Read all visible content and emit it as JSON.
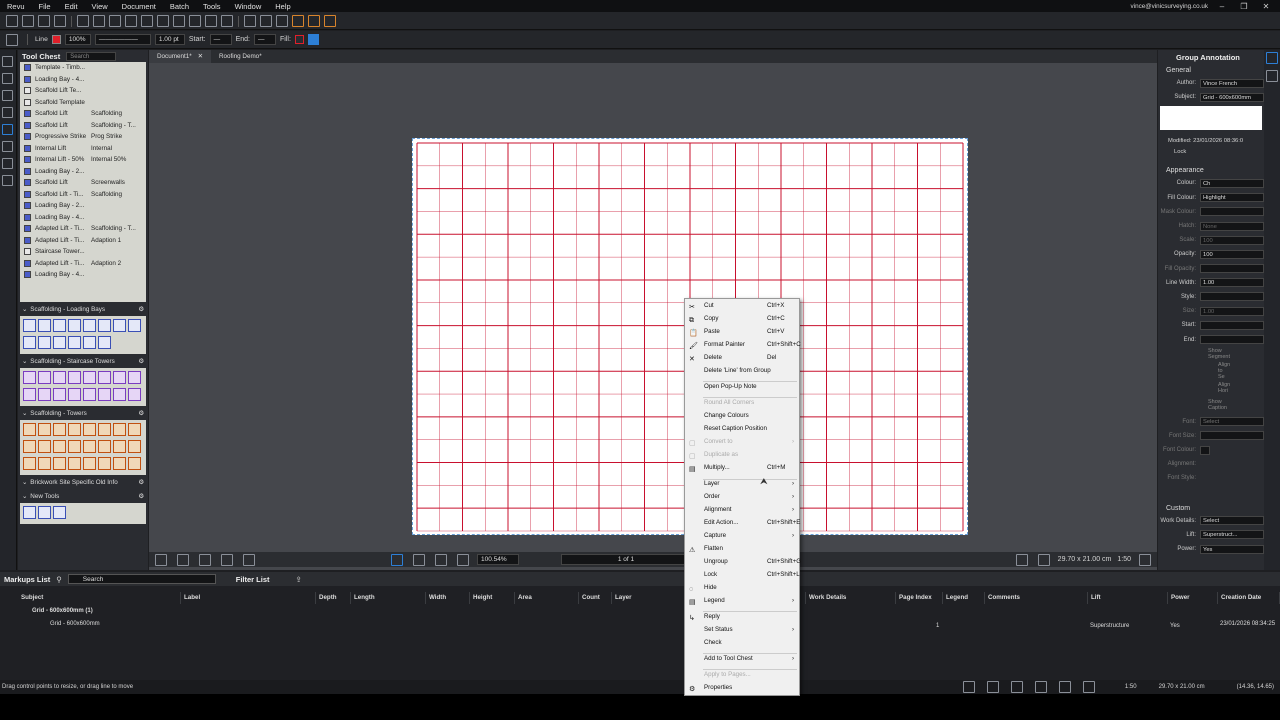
{
  "menubar": {
    "items": [
      "Revu",
      "File",
      "Edit",
      "View",
      "Document",
      "Batch",
      "Tools",
      "Window",
      "Help"
    ],
    "user": "vince@vinicsurveying.co.uk"
  },
  "toolbar2": {
    "tool": "Line",
    "zoom": "100%",
    "width": "1.00 pt",
    "start_label": "Start:",
    "end_label": "End:",
    "fill_label": "Fill:"
  },
  "toolchest": {
    "title": "Tool Chest",
    "search_placeholder": "Search",
    "items": [
      {
        "name": "Template - Timb...",
        "attr": ""
      },
      {
        "name": "Loading Bay - 4...",
        "attr": ""
      },
      {
        "name": "Scaffold Lift Te...",
        "attr": ""
      },
      {
        "name": "Scaffold Template",
        "attr": ""
      },
      {
        "name": "Scaffold Lift",
        "attr": "Scaffolding"
      },
      {
        "name": "Scaffold Lift",
        "attr": "Scaffolding - T..."
      },
      {
        "name": "Progressive Strike",
        "attr": "Prog Strike"
      },
      {
        "name": "Internal Lift",
        "attr": "Internal"
      },
      {
        "name": "Internal Lift - 50%",
        "attr": "Internal 50%"
      },
      {
        "name": "Loading Bay - 2...",
        "attr": ""
      },
      {
        "name": "Scaffold Lift",
        "attr": "Screenwalls"
      },
      {
        "name": "Scaffold Lift - Ti...",
        "attr": "Scaffolding"
      },
      {
        "name": "Loading Bay - 2...",
        "attr": ""
      },
      {
        "name": "Loading Bay - 4...",
        "attr": ""
      },
      {
        "name": "Adapted Lift - Ti...",
        "attr": "Scaffolding - T..."
      },
      {
        "name": "Adapted Lift - Ti...",
        "attr": "Adaption 1"
      },
      {
        "name": "Staircase Tower...",
        "attr": ""
      },
      {
        "name": "Adapted Lift - Ti...",
        "attr": "Adaption 2"
      },
      {
        "name": "Loading Bay - 4...",
        "attr": ""
      }
    ],
    "sections": [
      "Scaffolding - Loading Bays",
      "Scaffolding - Staircase Towers",
      "Scaffolding - Towers",
      "Brickwork Site Specific Old Info",
      "New Tools"
    ]
  },
  "tabs": [
    {
      "label": "Document1*"
    },
    {
      "label": "Roofing Demo*"
    }
  ],
  "bottombar": {
    "zoom": "100.54%",
    "page": "1 of 1",
    "size": "29.70 x 21.00 cm",
    "scale": "1:50"
  },
  "properties": {
    "title": "Group Annotation",
    "general": "General",
    "author_label": "Author:",
    "author": "Vince French",
    "subject_label": "Subject:",
    "subject": "Grid - 600x600mm",
    "modified": "Modified: 23/01/2026 08:36:0",
    "lock": "Lock",
    "appearance": "Appearance",
    "rows": [
      {
        "l": "Colour:",
        "v": "Ch",
        "dis": false
      },
      {
        "l": "Fill Colour:",
        "v": "Highlight",
        "dis": false
      },
      {
        "l": "Mask Colour:",
        "v": "",
        "dis": true
      },
      {
        "l": "Hatch:",
        "v": "None",
        "dis": true
      },
      {
        "l": "Scale:",
        "v": "100",
        "dis": true
      },
      {
        "l": "Opacity:",
        "v": "100",
        "dis": false
      },
      {
        "l": "Fill Opacity:",
        "v": "",
        "dis": true
      },
      {
        "l": "Line Width:",
        "v": "1.00",
        "dis": false
      },
      {
        "l": "Style:",
        "v": "",
        "dis": false
      },
      {
        "l": "Size:",
        "v": "1.00",
        "dis": true
      },
      {
        "l": "Start:",
        "v": "",
        "dis": false
      },
      {
        "l": "End:",
        "v": "",
        "dis": false
      }
    ],
    "show_segment": "Show Segment",
    "align_seg": "Align to Se",
    "align_hor": "Align Hori",
    "show_caption": "Show Caption",
    "font_label": "Font:",
    "font": "Select",
    "font_size": "Font Size:",
    "font_colour": "Font Colour:",
    "alignment": "Alignment:",
    "font_style": "Font Style:",
    "custom": "Custom",
    "work_details_label": "Work Details:",
    "work_details": "Select",
    "lift_label": "Lift:",
    "lift": "Superstruct...",
    "power_label": "Power:",
    "power": "Yes"
  },
  "markups": {
    "title": "Markups List",
    "search": "Search",
    "filter": "Filter List",
    "columns": [
      "Subject",
      "Label",
      "Depth",
      "Length",
      "Width",
      "Height",
      "Area",
      "Count",
      "Layer",
      "Work Details",
      "Page Index",
      "Legend",
      "Comments",
      "Lift",
      "Power",
      "Creation Date"
    ],
    "group": "Grid - 600x600mm (1)",
    "child": "Grid - 600x600mm",
    "page_index": "1",
    "lift": "Superstructure",
    "power": "Yes",
    "date": "23/01/2026 08:34:25"
  },
  "status": {
    "hint": "Drag control points to resize, or drag line to move",
    "scale": "1:50",
    "size": "29.70 x 21.00 cm",
    "coords": "(14.36, 14.65)"
  },
  "context_menu": [
    {
      "label": "Cut",
      "shortcut": "Ctrl+X",
      "icon": "✂",
      "dis": false,
      "arrow": false
    },
    {
      "label": "Copy",
      "shortcut": "Ctrl+C",
      "icon": "⧉",
      "dis": false,
      "arrow": false
    },
    {
      "label": "Paste",
      "shortcut": "Ctrl+V",
      "icon": "📋",
      "dis": false,
      "arrow": false
    },
    {
      "label": "Format Painter",
      "shortcut": "Ctrl+Shift+C",
      "icon": "🖌",
      "dis": false,
      "arrow": false
    },
    {
      "label": "Delete",
      "shortcut": "Del",
      "icon": "✕",
      "dis": false,
      "arrow": false
    },
    {
      "label": "Delete 'Line' from Group",
      "shortcut": "",
      "icon": "",
      "dis": false,
      "arrow": false
    },
    {
      "label": "Open Pop-Up Note",
      "shortcut": "",
      "icon": "",
      "dis": false,
      "arrow": false
    },
    {
      "label": "Round All Corners",
      "shortcut": "",
      "icon": "",
      "dis": true,
      "arrow": false
    },
    {
      "label": "Change Colours",
      "shortcut": "",
      "icon": "",
      "dis": false,
      "arrow": false
    },
    {
      "label": "Reset Caption Position",
      "shortcut": "",
      "icon": "",
      "dis": false,
      "arrow": false
    },
    {
      "label": "Convert to",
      "shortcut": "",
      "icon": "▢",
      "dis": true,
      "arrow": true
    },
    {
      "label": "Duplicate as",
      "shortcut": "",
      "icon": "▢",
      "dis": true,
      "arrow": false
    },
    {
      "label": "Multiply...",
      "shortcut": "Ctrl+M",
      "icon": "▤",
      "dis": false,
      "arrow": false
    },
    {
      "label": "Layer",
      "shortcut": "",
      "icon": "",
      "dis": false,
      "arrow": true
    },
    {
      "label": "Order",
      "shortcut": "",
      "icon": "",
      "dis": false,
      "arrow": true
    },
    {
      "label": "Alignment",
      "shortcut": "",
      "icon": "",
      "dis": false,
      "arrow": true
    },
    {
      "label": "Edit Action...",
      "shortcut": "Ctrl+Shift+E",
      "icon": "",
      "dis": false,
      "arrow": false
    },
    {
      "label": "Capture",
      "shortcut": "",
      "icon": "",
      "dis": false,
      "arrow": true
    },
    {
      "label": "Flatten",
      "shortcut": "",
      "icon": "⚠",
      "dis": false,
      "arrow": false
    },
    {
      "label": "Ungroup",
      "shortcut": "Ctrl+Shift+G",
      "icon": "",
      "dis": false,
      "arrow": false
    },
    {
      "label": "Lock",
      "shortcut": "Ctrl+Shift+L",
      "icon": "",
      "dis": false,
      "arrow": false
    },
    {
      "label": "Hide",
      "shortcut": "",
      "icon": "◌",
      "dis": false,
      "arrow": false
    },
    {
      "label": "Legend",
      "shortcut": "",
      "icon": "▤",
      "dis": false,
      "arrow": true
    },
    {
      "label": "Reply",
      "shortcut": "",
      "icon": "↳",
      "dis": false,
      "arrow": false
    },
    {
      "label": "Set Status",
      "shortcut": "",
      "icon": "",
      "dis": false,
      "arrow": true
    },
    {
      "label": "Check",
      "shortcut": "",
      "icon": "",
      "dis": false,
      "arrow": false
    },
    {
      "label": "Add to Tool Chest",
      "shortcut": "",
      "icon": "",
      "dis": false,
      "arrow": true
    },
    {
      "label": "Apply to Pages...",
      "shortcut": "",
      "icon": "",
      "dis": true,
      "arrow": false
    },
    {
      "label": "Properties",
      "shortcut": "",
      "icon": "⚙",
      "dis": false,
      "arrow": false
    }
  ],
  "colors": {
    "grid": "#c8102e",
    "accent": "#2d7fd6"
  }
}
